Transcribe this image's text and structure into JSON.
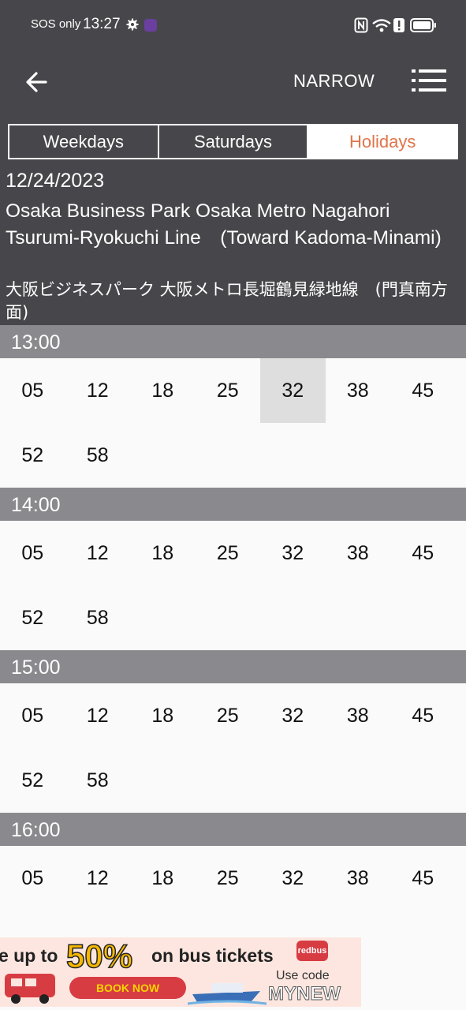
{
  "status_bar": {
    "carrier": "SOS only",
    "time": "13:27",
    "icons": [
      "gear-icon",
      "app-notification-icon",
      "nfc-icon",
      "wifi-icon",
      "alert-icon",
      "battery-icon"
    ]
  },
  "toolbar": {
    "back_icon": "arrow-left-icon",
    "narrow_label": "NARROW",
    "menu_icon": "list-menu-icon"
  },
  "tabs": [
    {
      "label": "Weekdays"
    },
    {
      "label": "Saturdays"
    },
    {
      "label": "Holidays"
    }
  ],
  "active_tab": "Holidays",
  "info": {
    "date": "12/24/2023",
    "station_en": "Osaka Business Park Osaka Metro Nagahori Tsurumi-Ryokuchi Line　(Toward Kadoma-Minami)",
    "station_ja": "大阪ビジネスパーク 大阪メトロ長堀鶴見緑地線　(門真南方面)"
  },
  "schedule": [
    {
      "hour": "13:00",
      "minutes": [
        "05",
        "12",
        "18",
        "25",
        "32",
        "38",
        "45",
        "52",
        "58"
      ],
      "selected": "32"
    },
    {
      "hour": "14:00",
      "minutes": [
        "05",
        "12",
        "18",
        "25",
        "32",
        "38",
        "45",
        "52",
        "58"
      ]
    },
    {
      "hour": "15:00",
      "minutes": [
        "05",
        "12",
        "18",
        "25",
        "32",
        "38",
        "45",
        "52",
        "58"
      ]
    },
    {
      "hour": "16:00",
      "minutes": [
        "05",
        "12",
        "18",
        "25",
        "32",
        "38",
        "45"
      ]
    }
  ],
  "ad": {
    "text_lead": "e up to",
    "percent": "50%",
    "text_tail": "on bus tickets",
    "button": "BOOK NOW",
    "code_label": "Use code",
    "code": "MYNEW",
    "brand": "redbus",
    "colors": {
      "background": "#fde6df",
      "accent": "#d83c43",
      "highlight": "#f6b800"
    }
  },
  "colors": {
    "header": "#47474b",
    "hour_band": "#8a8a8e",
    "active_tab_text": "#e0744a",
    "selected_cell": "#dedede"
  }
}
